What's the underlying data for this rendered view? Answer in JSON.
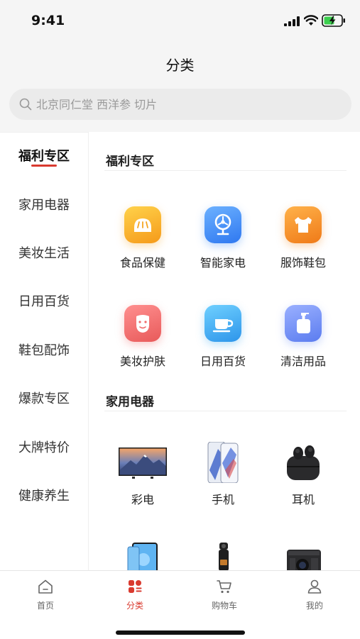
{
  "status_bar": {
    "time": "9:41"
  },
  "header": {
    "title": "分类"
  },
  "search": {
    "placeholder": "北京同仁堂 西洋参 切片"
  },
  "sidebar": {
    "items": [
      {
        "label": "福利专区",
        "active": true
      },
      {
        "label": "家用电器"
      },
      {
        "label": "美妆生活"
      },
      {
        "label": "日用百货"
      },
      {
        "label": "鞋包配饰"
      },
      {
        "label": "爆款专区"
      },
      {
        "label": "大牌特价"
      },
      {
        "label": "健康养生"
      }
    ]
  },
  "sections": [
    {
      "title": "福利专区",
      "items": [
        {
          "label": "食品保健",
          "icon": "bread-icon",
          "color": "#f5a623"
        },
        {
          "label": "智能家电",
          "icon": "fan-icon",
          "color": "#3d8af7"
        },
        {
          "label": "服饰鞋包",
          "icon": "tshirt-icon",
          "color": "#f08a24"
        },
        {
          "label": "美妆护肤",
          "icon": "face-mask-icon",
          "color": "#ef6b6b"
        },
        {
          "label": "日用百货",
          "icon": "cup-icon",
          "color": "#3fa8ef"
        },
        {
          "label": "清洁用品",
          "icon": "pump-bottle-icon",
          "color": "#6d8ef5"
        }
      ]
    },
    {
      "title": "家用电器",
      "items": [
        {
          "label": "彩电",
          "icon": "tv-image"
        },
        {
          "label": "手机",
          "icon": "phone-image"
        },
        {
          "label": "耳机",
          "icon": "earbuds-image"
        },
        {
          "label": "",
          "icon": "tablet-image"
        },
        {
          "label": "",
          "icon": "camera-image"
        },
        {
          "label": "",
          "icon": "projector-image"
        }
      ]
    }
  ],
  "tabbar": {
    "items": [
      {
        "label": "首页",
        "icon": "home-icon"
      },
      {
        "label": "分类",
        "icon": "category-icon",
        "active": true
      },
      {
        "label": "购物车",
        "icon": "cart-icon"
      },
      {
        "label": "我的",
        "icon": "profile-icon"
      }
    ]
  },
  "colors": {
    "accent": "#d93a2f",
    "background": "#f5f5f5"
  }
}
